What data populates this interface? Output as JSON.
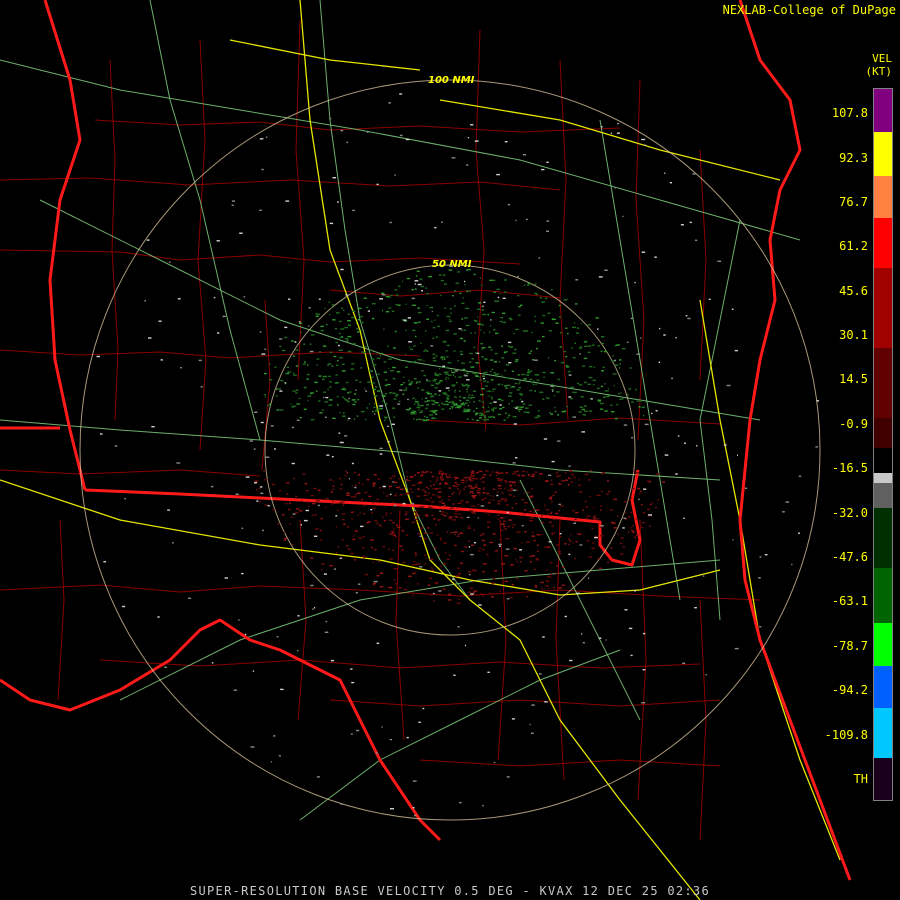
{
  "credit": "NEXLAB-College of DuPage",
  "legend": {
    "unit_line1": "VEL",
    "unit_line2": "(KT)",
    "labels": [
      "107.8",
      "92.3",
      "76.7",
      "61.2",
      "45.6",
      "30.1",
      "14.5",
      "-0.9",
      "-16.5",
      "-32.0",
      "-47.6",
      "-63.1",
      "-78.7",
      "-94.2",
      "-109.8",
      "TH"
    ],
    "colors": [
      "#800080",
      "#ffff00",
      "#ff8040",
      "#ff0000",
      "#a00000",
      "#600000",
      "#c8c8c8",
      "#006400",
      "#00ff00",
      "#0060ff",
      "#00c8ff",
      "#1a001a"
    ]
  },
  "range_rings": [
    "100 NMI",
    "50 NMI"
  ],
  "footer": "SUPER-RESOLUTION BASE VELOCITY 0.5 DEG - KVAX 12 DEC 25 02:36"
}
